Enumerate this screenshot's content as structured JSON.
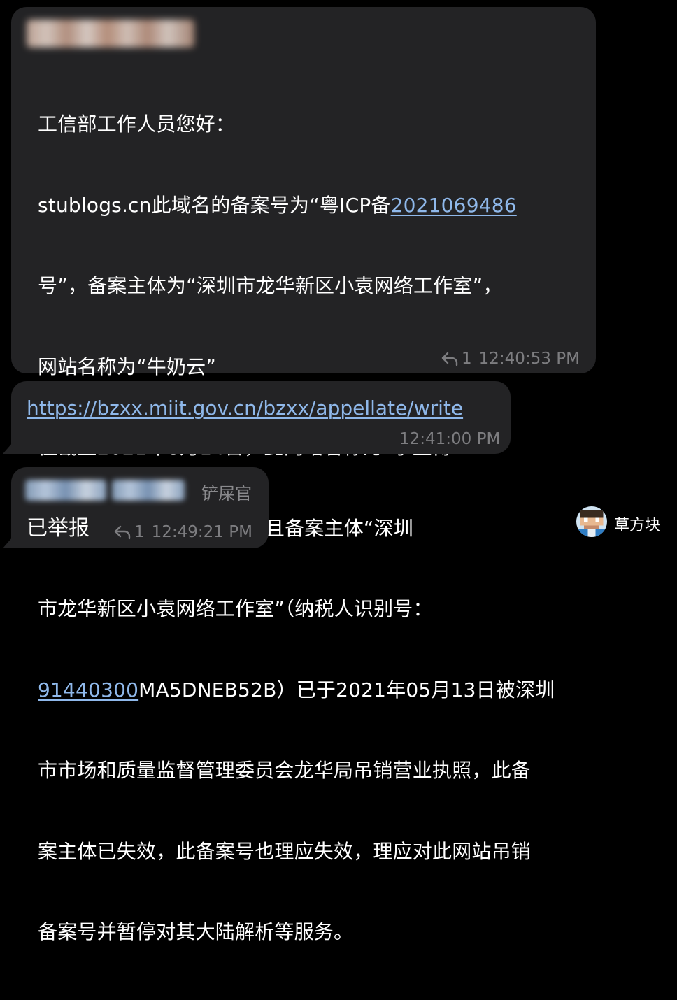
{
  "message1": {
    "lines": [
      "工信部工作人员您好：",
      "stublogs.cn此域名的备案号为“粤ICP备",
      "号”，备案主体为“深圳市龙华新区小袁网络工作室”，",
      "网站名称为“牛奶云”",
      "但截至2021年8月14日，此网站名称为“学生博",
      "客联盟”与实际备案不符，且备案主体“深圳",
      "市龙华新区小袁网络工作室”（纳税人识别号：",
      "",
      "市市场和质量监督管理委员会龙华局吊销营业执照，此备",
      "案主体已失效，此备案号也理应失效，理应对此网站吊销",
      "备案号并暂停对其大陆解析等服务。"
    ],
    "icp_link": "2021069486",
    "tax_id_link": "91440300",
    "tax_id_rest": "MA5DNEB52B）已于2021年05月13日被深圳",
    "reply_count": "1",
    "time": "12:40:53 PM"
  },
  "message2": {
    "link": "https://bzxx.miit.gov.cn/bzxx/appellate/write",
    "time": "12:41:00 PM"
  },
  "message3": {
    "admin_title": "铲屎官",
    "text": "已举报",
    "reply_count": "1",
    "time": "12:49:21 PM"
  },
  "author": {
    "name": "草方块"
  },
  "colors": {
    "background": "#000000",
    "bubble": "#232325",
    "link": "#8fb8ea",
    "meta": "#7d7d80"
  }
}
